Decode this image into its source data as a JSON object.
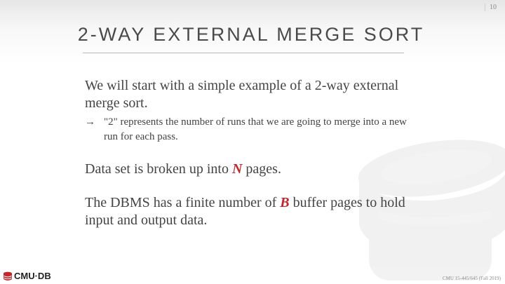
{
  "slide": {
    "page_number": "10",
    "title": "2-WAY EXTERNAL MERGE SORT",
    "bullets": [
      {
        "text": "We will start with a simple example of a 2-way external merge sort.",
        "sub": {
          "arrow": "→",
          "text": "\"2\" represents the number of runs that we are going to merge into a new run for each pass."
        }
      },
      {
        "before": "Data set is broken up into ",
        "emphasis": "N",
        "after": " pages."
      },
      {
        "before": "The DBMS has a finite number of ",
        "emphasis": "B",
        "after": " buffer pages to hold input and output data."
      }
    ]
  },
  "footer": {
    "logo_text": "CMU·DB",
    "course": "CMU 15-445/645 (Fall 2019)"
  },
  "colors": {
    "emphasis": "#c0282d",
    "logo": "#c0282d",
    "text": "#444444"
  },
  "icons": {
    "watermark": "database-cylinder-icon",
    "logo": "database-logo-icon"
  }
}
